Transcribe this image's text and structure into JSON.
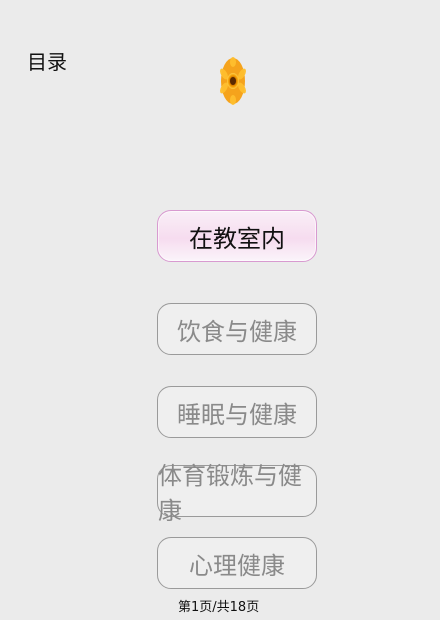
{
  "header": {
    "title": "目录"
  },
  "menu": {
    "items": [
      {
        "label": "在教室内",
        "active": true
      },
      {
        "label": "饮食与健康",
        "active": false
      },
      {
        "label": "睡眠与健康",
        "active": false
      },
      {
        "label": "体育锻炼与健康",
        "active": false
      },
      {
        "label": "心理健康",
        "active": false
      }
    ]
  },
  "footer": {
    "page_info": "第1页/共18页"
  },
  "colors": {
    "background": "#ebebeb",
    "active_border": "#d89ad0",
    "active_fill": "#f6dcef",
    "inactive_text": "#8a8a8a",
    "inactive_border": "#9a9a9a"
  },
  "icons": {
    "decoration": "flower-icon"
  }
}
